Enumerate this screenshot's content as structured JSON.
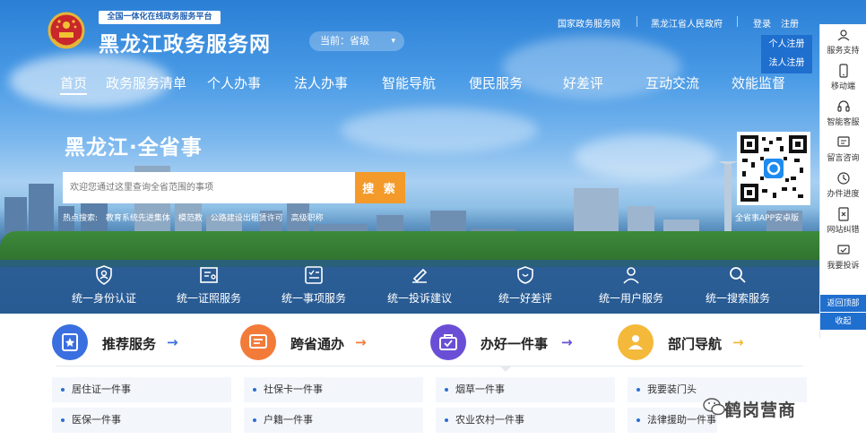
{
  "header": {
    "tagline": "全国一体化在线政务服务平台",
    "site_title": "黑龙江政务服务网",
    "region_label": "当前：省级",
    "top_links": {
      "national": "国家政务服务网",
      "province": "黑龙江省人民政府",
      "login": "登录",
      "register": "注册"
    },
    "register_menu": {
      "personal": "个人注册",
      "legal": "法人注册"
    }
  },
  "nav": [
    "首页",
    "政务服务清单",
    "个人办事",
    "法人办事",
    "智能导航",
    "便民服务",
    "好差评",
    "互动交流",
    "效能监督"
  ],
  "hero": {
    "title": "黑龙江·全省事",
    "search_placeholder": "欢迎您通过这里查询全省范围的事项",
    "search_button": "搜 索",
    "hot_label": "热点搜索:",
    "hot_items": [
      "教育系统先进集体",
      "模范教",
      "公路建设出租赁许可",
      "高级职称"
    ],
    "qr_caption": "全省事APP安卓版"
  },
  "services": [
    "统一身份认证",
    "统一证照服务",
    "统一事项服务",
    "统一投诉建议",
    "统一好差评",
    "统一用户服务",
    "统一搜索服务"
  ],
  "side": {
    "items": [
      "服务支持",
      "移动端",
      "智能客服",
      "留言咨询",
      "办件进度",
      "网站纠错",
      "我要投诉"
    ],
    "back_top": "返回顶部",
    "collapse": "收起"
  },
  "categories": [
    {
      "title": "推荐服务",
      "color": "#3a6fe0",
      "arrow_color": "#3a6fe0"
    },
    {
      "title": "跨省通办",
      "color": "#f27b3a",
      "arrow_color": "#f27b3a"
    },
    {
      "title": "办好一件事",
      "color": "#6a4fd6",
      "arrow_color": "#6a4fd6"
    },
    {
      "title": "部门导航",
      "color": "#f4b93a",
      "arrow_color": "#f4b93a"
    }
  ],
  "lists": {
    "col1": [
      "居住证一件事",
      "医保一件事"
    ],
    "col2": [
      "社保卡一件事",
      "户籍一件事"
    ],
    "col3": [
      "烟草一件事",
      "农业农村一件事"
    ],
    "col4": [
      "我要装门头",
      "法律援助一件事"
    ]
  },
  "watermark": "鹤岗营商"
}
